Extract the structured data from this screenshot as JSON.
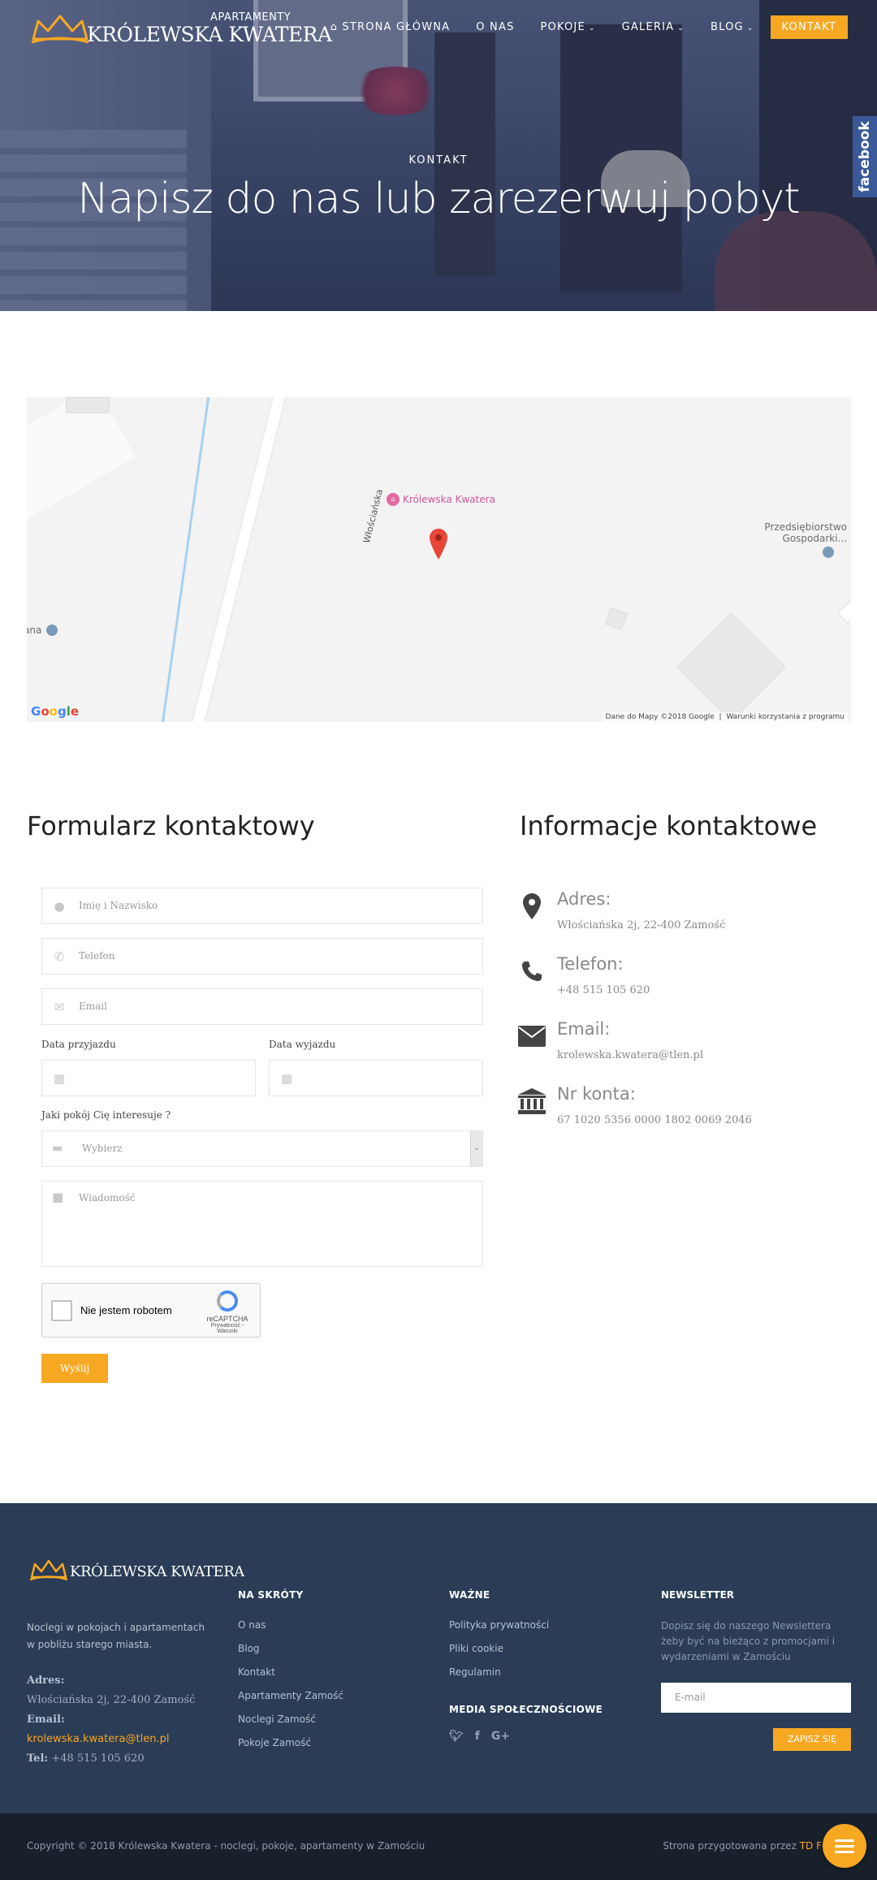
{
  "header": {
    "logo_sub": "APARTAMENTY",
    "logo_name": "KRÓLEWSKA KWATERA",
    "nav": [
      {
        "label": "STRONA GŁÓWNA",
        "icon": "home-icon"
      },
      {
        "label": "O NAS"
      },
      {
        "label": "POKOJE",
        "dropdown": true
      },
      {
        "label": "GALERIA",
        "dropdown": true
      },
      {
        "label": "BLOG",
        "dropdown": true
      }
    ],
    "cta": "KONTAKT",
    "facebook_tab": "facebook"
  },
  "hero": {
    "kicker": "KONTAKT",
    "title": "Napisz do nas lub zarezerwuj pobyt"
  },
  "map": {
    "street": "Włościańska",
    "place_name": "Królewska Kwatera",
    "poi_right": "Przedsiębiorstwo\nGospodarki...",
    "poi_left": "ana",
    "google": "Google",
    "attribution": "Dane do Mapy ©2018 Google",
    "terms": "Warunki korzystania z programu"
  },
  "form": {
    "title": "Formularz kontaktowy",
    "name_placeholder": "Imię i Nazwisko",
    "phone_placeholder": "Telefon",
    "email_placeholder": "Email",
    "arrival_label": "Data przyjazdu",
    "departure_label": "Data wyjazdu",
    "room_label": "Jaki pokój Cię interesuje ?",
    "room_selected": "Wybierz",
    "message_placeholder": "Wiadomość",
    "captcha_text": "Nie jestem robotem",
    "captcha_brand": "reCAPTCHA",
    "captcha_links": "Prywatność - Warunki",
    "submit": "Wyślij"
  },
  "info": {
    "title": "Informacje kontaktowe",
    "items": [
      {
        "label": "Adres:",
        "value": "Włościańska 2j, 22-400 Zamość",
        "icon": "map-marker-icon"
      },
      {
        "label": "Telefon:",
        "value": "+48 515 105 620",
        "icon": "phone-icon"
      },
      {
        "label": "Email:",
        "value": "krolewska.kwatera@tlen.pl",
        "icon": "envelope-icon"
      },
      {
        "label": "Nr konta:",
        "value": "67 1020 5356 0000 1802 0069 2046",
        "icon": "bank-icon"
      }
    ]
  },
  "footer": {
    "logo_name": "KRÓLEWSKA KWATERA",
    "description": "Noclegi w pokojach i apartamentach w pobliżu starego miasta.",
    "address_label": "Adres:",
    "address": "Włościańska 2j, 22-400 Zamość",
    "email_label": "Email:",
    "email": "krolewska.kwatera@tlen.pl",
    "phone_label": "Tel:",
    "phone": "+48 515 105 620",
    "shortcuts_title": "NA SKRÓTY",
    "shortcuts": [
      "O nas",
      "Blog",
      "Kontakt",
      "Apartamenty Zamość",
      "Noclegi Zamość",
      "Pokoje Zamość"
    ],
    "important_title": "WAŻNE",
    "important": [
      "Polityka prywatności",
      "Pliki cookie",
      "Regulamin"
    ],
    "social_title": "MEDIA SPOŁECZNOŚCIOWE",
    "social": [
      "twitter-icon",
      "facebook-icon",
      "google-plus-icon"
    ],
    "newsletter_title": "NEWSLETTER",
    "newsletter_text": "Dopisz się do naszego Newslettera żeby być na bieżąco z promocjami i wydarzeniami w Zamościu",
    "newsletter_placeholder": "E-mail",
    "newsletter_button": "ZAPISZ SIĘ",
    "copyright": "Copyright © 2018 Królewska Kwatera - noclegi, pokoje, apartamenty w Zamościu",
    "made_by": "Strona przygotowana przez",
    "made_by_link": "TD F"
  },
  "colors": {
    "accent": "#f7a823",
    "footer_bg": "#2a3c56",
    "footer_bottom": "#18202c"
  }
}
